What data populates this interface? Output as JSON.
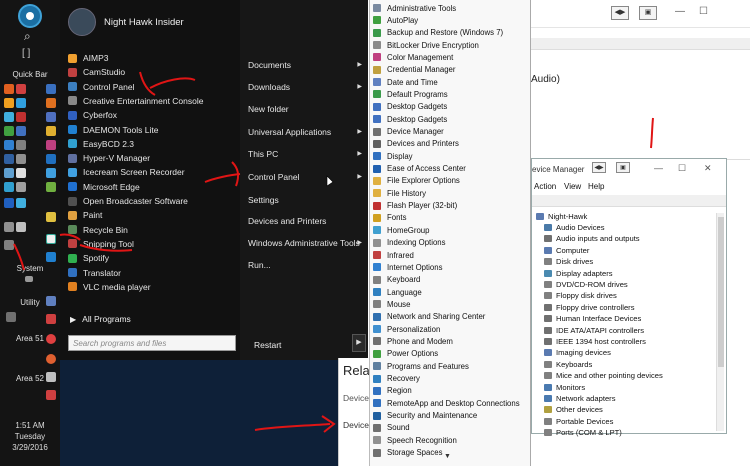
{
  "taskbar": {
    "quick_bar_label": "Quick Bar",
    "system_label": "System",
    "utility_label": "Utility",
    "area51_label": "Area 51",
    "area52_label": "Area 52",
    "brackets": "[ ]",
    "search_glyph": "⌕",
    "clock": {
      "time": "1:51 AM",
      "day": "Tuesday",
      "date": "3/29/2016"
    }
  },
  "start_menu": {
    "user_name": "Night Hawk Insider",
    "apps": [
      {
        "label": "AIMP3",
        "color": "#f0a030"
      },
      {
        "label": "CamStudio",
        "color": "#c04040"
      },
      {
        "label": "Control Panel",
        "color": "#3c7fc0"
      },
      {
        "label": "Creative Entertainment Console",
        "color": "#888888"
      },
      {
        "label": "Cyberfox",
        "color": "#3060c0"
      },
      {
        "label": "DAEMON Tools Lite",
        "color": "#2080d0"
      },
      {
        "label": "EasyBCD 2.3",
        "color": "#30a0d0"
      },
      {
        "label": "Hyper-V Manager",
        "color": "#6070a0"
      },
      {
        "label": "Icecream Screen Recorder",
        "color": "#40a0e0"
      },
      {
        "label": "Microsoft Edge",
        "color": "#2070d0"
      },
      {
        "label": "Open Broadcaster Software",
        "color": "#505050"
      },
      {
        "label": "Paint",
        "color": "#e0a040"
      },
      {
        "label": "Recycle Bin",
        "color": "#5a8a5a"
      },
      {
        "label": "Snipping Tool",
        "color": "#c04040"
      },
      {
        "label": "Spotify",
        "color": "#30b050"
      },
      {
        "label": "Translator",
        "color": "#3070c0"
      },
      {
        "label": "VLC media player",
        "color": "#e08020"
      }
    ],
    "all_programs": "All Programs",
    "search_placeholder": "Search programs and files",
    "right_items": [
      {
        "label": "Documents",
        "arrow": true
      },
      {
        "label": "Downloads",
        "arrow": true
      },
      {
        "label": "New folder",
        "arrow": false
      },
      {
        "label": "Universal Applications",
        "arrow": true
      },
      {
        "label": "This PC",
        "arrow": true
      },
      {
        "label": "Control Panel",
        "arrow": true
      },
      {
        "label": "Settings",
        "arrow": false
      },
      {
        "label": "Devices and Printers",
        "arrow": false
      },
      {
        "label": "Windows Administrative Tools",
        "arrow": true
      },
      {
        "label": "Run...",
        "arrow": false
      }
    ],
    "restart": "Restart",
    "restart_arrow": "▶"
  },
  "control_panel_menu": {
    "items": [
      {
        "label": "Administrative Tools",
        "color": "#7a8aa0"
      },
      {
        "label": "AutoPlay",
        "color": "#40a040"
      },
      {
        "label": "Backup and Restore (Windows 7)",
        "color": "#3a9a4a"
      },
      {
        "label": "BitLocker Drive Encryption",
        "color": "#8a8a8a"
      },
      {
        "label": "Color Management",
        "color": "#c04080"
      },
      {
        "label": "Credential Manager",
        "color": "#c0a040"
      },
      {
        "label": "Date and Time",
        "color": "#6080c0"
      },
      {
        "label": "Default Programs",
        "color": "#3a9a4a"
      },
      {
        "label": "Desktop Gadgets",
        "color": "#4070c0"
      },
      {
        "label": "Desktop Gadgets",
        "color": "#4070c0"
      },
      {
        "label": "Device Manager",
        "color": "#707070"
      },
      {
        "label": "Devices and Printers",
        "color": "#606060"
      },
      {
        "label": "Display",
        "color": "#3070c0"
      },
      {
        "label": "Ease of Access Center",
        "color": "#2060b0"
      },
      {
        "label": "File Explorer Options",
        "color": "#e0b040"
      },
      {
        "label": "File History",
        "color": "#e0b040"
      },
      {
        "label": "Flash Player (32-bit)",
        "color": "#c03030"
      },
      {
        "label": "Fonts",
        "color": "#d0a020"
      },
      {
        "label": "HomeGroup",
        "color": "#40a0d0"
      },
      {
        "label": "Indexing Options",
        "color": "#909090"
      },
      {
        "label": "Infrared",
        "color": "#c04040"
      },
      {
        "label": "Internet Options",
        "color": "#3080d0"
      },
      {
        "label": "Keyboard",
        "color": "#808080"
      },
      {
        "label": "Language",
        "color": "#3080c0"
      },
      {
        "label": "Mouse",
        "color": "#808080"
      },
      {
        "label": "Network and Sharing Center",
        "color": "#3070b0"
      },
      {
        "label": "Personalization",
        "color": "#4090d0"
      },
      {
        "label": "Phone and Modem",
        "color": "#707070"
      },
      {
        "label": "Power Options",
        "color": "#40a040"
      },
      {
        "label": "Programs and Features",
        "color": "#6080a0"
      },
      {
        "label": "Recovery",
        "color": "#3080c0"
      },
      {
        "label": "Region",
        "color": "#3070c0"
      },
      {
        "label": "RemoteApp and Desktop Connections",
        "color": "#3070c0"
      },
      {
        "label": "Security and Maintenance",
        "color": "#2060a0"
      },
      {
        "label": "Sound",
        "color": "#707070"
      },
      {
        "label": "Speech Recognition",
        "color": "#909090"
      },
      {
        "label": "Storage Spaces",
        "color": "#707070"
      }
    ],
    "more_glyph": "▼"
  },
  "background_window": {
    "audio_text": "Audio)",
    "btn_nav": "◀▶",
    "btn_view": "▣",
    "ctl_min": "—",
    "ctl_max": "☐"
  },
  "related_panel": {
    "title": "Rela",
    "line1": "Device",
    "line2": "Device"
  },
  "device_manager": {
    "title": "evice Manager",
    "ctl_min": "—",
    "ctl_max": "☐",
    "ctl_close": "✕",
    "menu": [
      "Action",
      "View",
      "Help"
    ],
    "root": "Night-Hawk",
    "nodes": [
      {
        "label": "Audio Devices",
        "color": "#4a7aa8"
      },
      {
        "label": "Audio inputs and outputs",
        "color": "#707070"
      },
      {
        "label": "Computer",
        "color": "#5a7ab0"
      },
      {
        "label": "Disk drives",
        "color": "#808080"
      },
      {
        "label": "Display adapters",
        "color": "#4a8ab0"
      },
      {
        "label": "DVD/CD-ROM drives",
        "color": "#808080"
      },
      {
        "label": "Floppy disk drives",
        "color": "#808080"
      },
      {
        "label": "Floppy drive controllers",
        "color": "#707070"
      },
      {
        "label": "Human Interface Devices",
        "color": "#707070"
      },
      {
        "label": "IDE ATA/ATAPI controllers",
        "color": "#707070"
      },
      {
        "label": "IEEE 1394 host controllers",
        "color": "#707070"
      },
      {
        "label": "Imaging devices",
        "color": "#5a7ab0"
      },
      {
        "label": "Keyboards",
        "color": "#808080"
      },
      {
        "label": "Mice and other pointing devices",
        "color": "#808080"
      },
      {
        "label": "Monitors",
        "color": "#4a7ab0"
      },
      {
        "label": "Network adapters",
        "color": "#4a7ab0"
      },
      {
        "label": "Other devices",
        "color": "#b0a040"
      },
      {
        "label": "Portable Devices",
        "color": "#808080"
      },
      {
        "label": "Ports (COM & LPT)",
        "color": "#808080"
      }
    ]
  }
}
